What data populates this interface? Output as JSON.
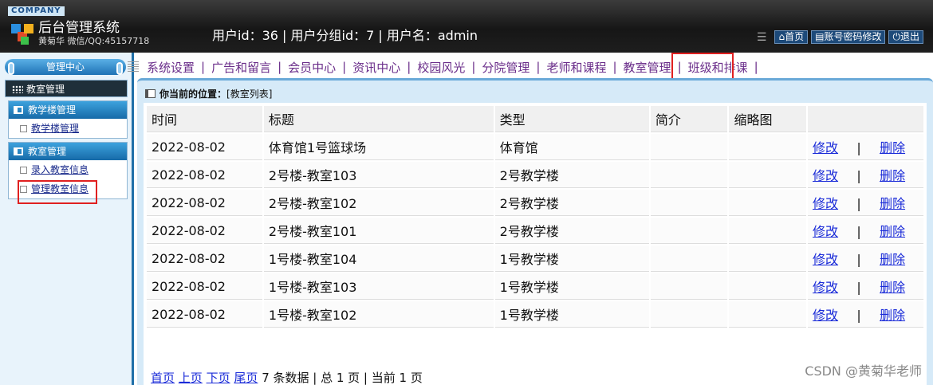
{
  "header": {
    "company_label": "COMPANY",
    "title": "后台管理系统",
    "subtitle": "黄菊华 微信/QQ:45157718",
    "user_info": "用户id：36 | 用户分组id：7 | 用户名：admin",
    "buttons": [
      {
        "icon": "home-icon",
        "label": "首页"
      },
      {
        "icon": "account-icon",
        "label": "账号密码修改"
      },
      {
        "icon": "power-icon",
        "label": "退出"
      }
    ]
  },
  "sidebar": {
    "top_label": "管理中心",
    "active_label": "教室管理",
    "groups": [
      {
        "title": "教学楼管理",
        "items": [
          {
            "label": "教学楼管理"
          }
        ]
      },
      {
        "title": "教室管理",
        "items": [
          {
            "label": "录入教室信息"
          },
          {
            "label": "管理教室信息"
          }
        ]
      }
    ]
  },
  "topnav": {
    "items": [
      {
        "label": "系统设置"
      },
      {
        "label": "广告和留言"
      },
      {
        "label": "会员中心"
      },
      {
        "label": "资讯中心"
      },
      {
        "label": "校园风光"
      },
      {
        "label": "分院管理"
      },
      {
        "label": "老师和课程"
      },
      {
        "label": "教室管理"
      },
      {
        "label": "班级和排课"
      }
    ],
    "separator": "|"
  },
  "breadcrumb": {
    "prefix": "你当前的位置：",
    "current": "[教室列表]"
  },
  "table": {
    "headers": [
      "时间",
      "标题",
      "类型",
      "简介",
      "缩略图",
      ""
    ],
    "edit_label": "修改",
    "delete_label": "删除",
    "op_separator": "|",
    "rows": [
      {
        "time": "2022-08-02",
        "title": "体育馆1号篮球场",
        "type": "体育馆",
        "intro": "",
        "thumb": ""
      },
      {
        "time": "2022-08-02",
        "title": "2号楼-教室103",
        "type": "2号教学楼",
        "intro": "",
        "thumb": ""
      },
      {
        "time": "2022-08-02",
        "title": "2号楼-教室102",
        "type": "2号教学楼",
        "intro": "",
        "thumb": ""
      },
      {
        "time": "2022-08-02",
        "title": "2号楼-教室101",
        "type": "2号教学楼",
        "intro": "",
        "thumb": ""
      },
      {
        "time": "2022-08-02",
        "title": "1号楼-教室104",
        "type": "1号教学楼",
        "intro": "",
        "thumb": ""
      },
      {
        "time": "2022-08-02",
        "title": "1号楼-教室103",
        "type": "1号教学楼",
        "intro": "",
        "thumb": ""
      },
      {
        "time": "2022-08-02",
        "title": "1号楼-教室102",
        "type": "1号教学楼",
        "intro": "",
        "thumb": ""
      }
    ]
  },
  "pager": {
    "first": "首页",
    "prev": "上页",
    "next": "下页",
    "last": "尾页",
    "summary": "7 条数据 | 总 1 页 | 当前 1 页"
  },
  "watermark": "CSDN @黄菊华老师",
  "colors": {
    "highlight": "#e02020",
    "link": "#1a2bd8",
    "nav_text": "#6a2d8a"
  }
}
